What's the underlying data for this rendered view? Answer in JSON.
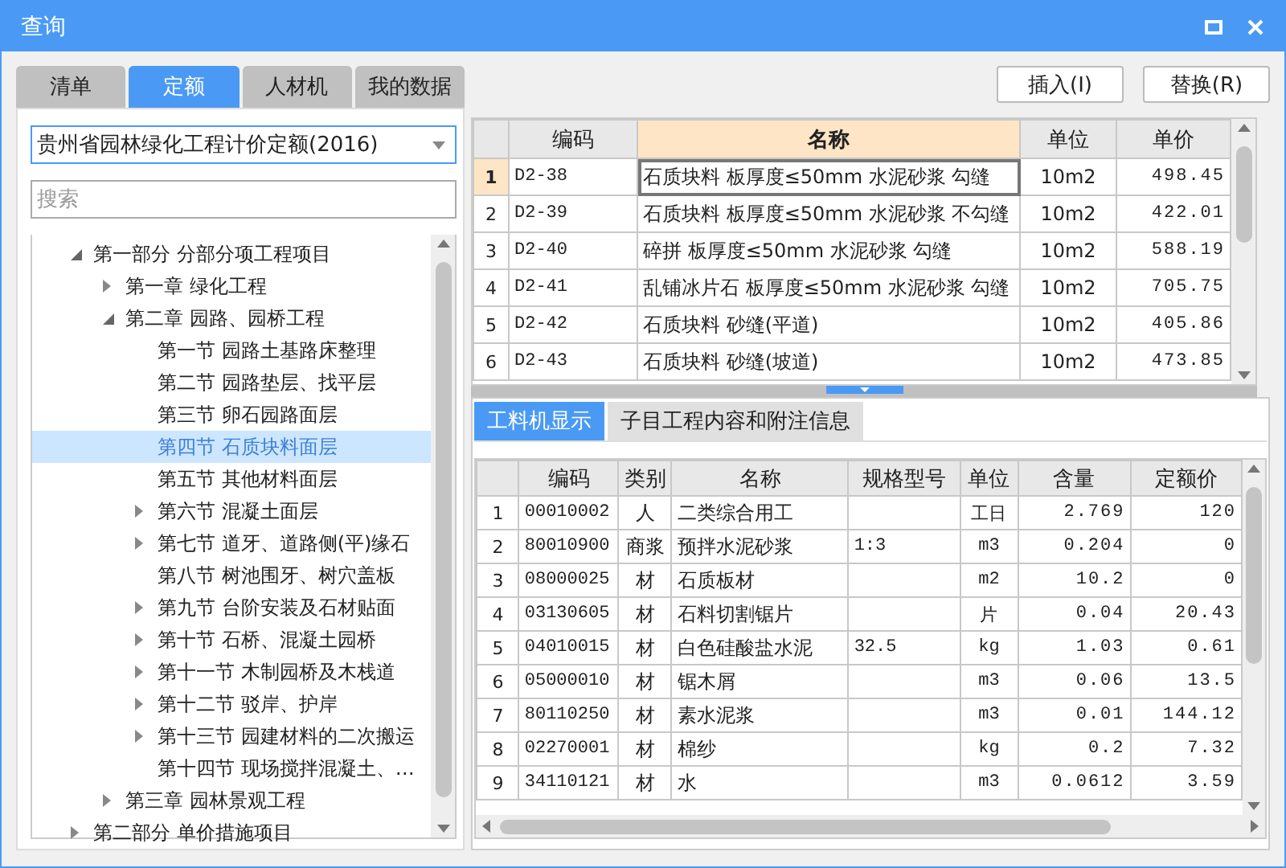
{
  "window": {
    "title": "查询"
  },
  "tabs": [
    {
      "label": "清单",
      "selected": false
    },
    {
      "label": "定额",
      "selected": true
    },
    {
      "label": "人材机",
      "selected": false
    },
    {
      "label": "我的数据",
      "selected": false
    }
  ],
  "library_select": {
    "value": "贵州省园林绿化工程计价定额(2016)"
  },
  "search": {
    "placeholder": "搜索"
  },
  "tree": [
    {
      "label": "第一部分 分部分项工程项目",
      "kind": "branch",
      "expanded": true,
      "selected": false,
      "children": [
        {
          "label": "第一章 绿化工程",
          "kind": "branch",
          "expanded": false,
          "selected": false
        },
        {
          "label": "第二章 园路、园桥工程",
          "kind": "branch",
          "expanded": true,
          "selected": false,
          "children": [
            {
              "label": "第一节 园路土基路床整理",
              "kind": "leaf",
              "expanded": false,
              "selected": false
            },
            {
              "label": "第二节 园路垫层、找平层",
              "kind": "leaf",
              "expanded": false,
              "selected": false
            },
            {
              "label": "第三节 卵石园路面层",
              "kind": "leaf",
              "expanded": false,
              "selected": false
            },
            {
              "label": "第四节 石质块料面层",
              "kind": "leaf",
              "expanded": false,
              "selected": true
            },
            {
              "label": "第五节 其他材料面层",
              "kind": "leaf",
              "expanded": false,
              "selected": false
            },
            {
              "label": "第六节 混凝土面层",
              "kind": "branch",
              "expanded": false,
              "selected": false
            },
            {
              "label": "第七节 道牙、道路侧(平)缘石",
              "kind": "branch",
              "expanded": false,
              "selected": false
            },
            {
              "label": "第八节 树池围牙、树穴盖板",
              "kind": "leaf",
              "expanded": false,
              "selected": false
            },
            {
              "label": "第九节 台阶安装及石材贴面",
              "kind": "branch",
              "expanded": false,
              "selected": false
            },
            {
              "label": "第十节 石桥、混凝土园桥",
              "kind": "branch",
              "expanded": false,
              "selected": false
            },
            {
              "label": "第十一节 木制园桥及木栈道",
              "kind": "branch",
              "expanded": false,
              "selected": false
            },
            {
              "label": "第十二节 驳岸、护岸",
              "kind": "branch",
              "expanded": false,
              "selected": false
            },
            {
              "label": "第十三节 园建材料的二次搬运",
              "kind": "branch",
              "expanded": false,
              "selected": false
            },
            {
              "label": "第十四节 现场搅拌混凝土、…",
              "kind": "leaf",
              "expanded": false,
              "selected": false
            }
          ]
        },
        {
          "label": "第三章 园林景观工程",
          "kind": "branch",
          "expanded": false,
          "selected": false
        }
      ]
    },
    {
      "label": "第二部分 单价措施项目",
      "kind": "branch",
      "expanded": false,
      "selected": false
    }
  ],
  "buttons": [
    {
      "label": "插入(I)"
    },
    {
      "label": "替换(R)"
    }
  ],
  "quota_table": {
    "columns": [
      {
        "label": "编码",
        "current": false
      },
      {
        "label": "名称",
        "current": true
      },
      {
        "label": "单位",
        "current": false
      },
      {
        "label": "单价",
        "current": false
      }
    ],
    "rows": [
      {
        "index": "1",
        "selected": true,
        "cells": [
          "D2-38",
          "石质块料 板厚度≤50mm 水泥砂浆 勾缝",
          "10m2",
          "498.45"
        ]
      },
      {
        "index": "2",
        "selected": false,
        "cells": [
          "D2-39",
          "石质块料 板厚度≤50mm 水泥砂浆 不勾缝",
          "10m2",
          "422.01"
        ]
      },
      {
        "index": "3",
        "selected": false,
        "cells": [
          "D2-40",
          "碎拼 板厚度≤50mm 水泥砂浆 勾缝",
          "10m2",
          "588.19"
        ]
      },
      {
        "index": "4",
        "selected": false,
        "cells": [
          "D2-41",
          "乱铺冰片石 板厚度≤50mm 水泥砂浆 勾缝",
          "10m2",
          "705.75"
        ]
      },
      {
        "index": "5",
        "selected": false,
        "cells": [
          "D2-42",
          "石质块料 砂缝(平道)",
          "10m2",
          "405.86"
        ]
      },
      {
        "index": "6",
        "selected": false,
        "cells": [
          "D2-43",
          "石质块料 砂缝(坡道)",
          "10m2",
          "473.85"
        ]
      }
    ]
  },
  "detail_tabs": [
    {
      "label": "工料机显示",
      "selected": true
    },
    {
      "label": "子目工程内容和附注信息",
      "selected": false
    }
  ],
  "resource_table": {
    "columns": [
      "编码",
      "类别",
      "名称",
      "规格型号",
      "单位",
      "含量",
      "定额价"
    ],
    "rows": [
      {
        "index": "1",
        "cells": [
          "00010002",
          "人",
          "二类综合用工",
          "",
          "工日",
          "2.769",
          "120"
        ]
      },
      {
        "index": "2",
        "cells": [
          "80010900",
          "商浆",
          "预拌水泥砂浆",
          "1:3",
          "m3",
          "0.204",
          "0"
        ]
      },
      {
        "index": "3",
        "cells": [
          "08000025",
          "材",
          "石质板材",
          "",
          "m2",
          "10.2",
          "0"
        ]
      },
      {
        "index": "4",
        "cells": [
          "03130605",
          "材",
          "石料切割锯片",
          "",
          "片",
          "0.04",
          "20.43"
        ]
      },
      {
        "index": "5",
        "cells": [
          "04010015",
          "材",
          "白色硅酸盐水泥",
          "32.5",
          "kg",
          "1.03",
          "0.61"
        ]
      },
      {
        "index": "6",
        "cells": [
          "05000010",
          "材",
          "锯木屑",
          "",
          "m3",
          "0.06",
          "13.5"
        ]
      },
      {
        "index": "7",
        "cells": [
          "80110250",
          "材",
          "素水泥浆",
          "",
          "m3",
          "0.01",
          "144.12"
        ]
      },
      {
        "index": "8",
        "cells": [
          "02270001",
          "材",
          "棉纱",
          "",
          "kg",
          "0.2",
          "7.32"
        ]
      },
      {
        "index": "9",
        "cells": [
          "34110121",
          "材",
          "水",
          "",
          "m3",
          "0.0612",
          "3.59"
        ]
      }
    ]
  }
}
